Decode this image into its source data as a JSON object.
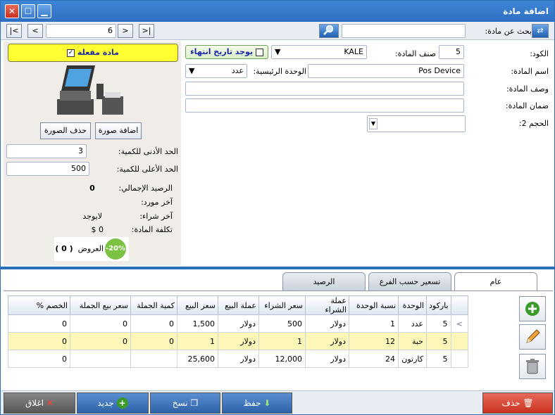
{
  "window": {
    "title": "اضافة مادة"
  },
  "nav": {
    "first": "|<",
    "prev": "<",
    "record": "6",
    "next": ">",
    "last": ">|",
    "search_label": "بحث عن مادة:",
    "search_value": ""
  },
  "left": {
    "active_label": "مادة مفعلة",
    "add_image": "اضافة صورة",
    "delete_image": "حذف الصورة",
    "min_qty_label": "الحد الأدنى للكمية:",
    "min_qty": "3",
    "max_qty_label": "الحد الأعلى للكمية:",
    "max_qty": "500",
    "total_balance_label": "الرصيد الإجمالي:",
    "total_balance": "0",
    "last_supplier_label": "آخر مورد:",
    "last_supplier": "",
    "last_purchase_label": "آخر شراء:",
    "last_purchase": "لايوجد",
    "cost_label": "تكلفة المادة:",
    "cost": "0 $",
    "offers_label": "العروض",
    "offers_count": "( 0 )",
    "discount_badge": "-20%"
  },
  "form": {
    "code_label": "الكود:",
    "code": "",
    "category_label": "صنف المادة:",
    "category_num": "5",
    "category": "KALE",
    "expiry_label": "يوجد تاريخ انتهاء",
    "name_label": "اسم المادة:",
    "name": "Pos Device",
    "unit_label": "الوحدة الرئيسية:",
    "unit": "عدد",
    "desc_label": "وصف المادة:",
    "desc": "",
    "warranty_label": "ضمان المادة:",
    "warranty": "",
    "size_label": "الحجم 2:",
    "size": ""
  },
  "tabs": [
    {
      "label": "عام"
    },
    {
      "label": "تسعير حسب الفرع"
    },
    {
      "label": "الرصيد"
    }
  ],
  "grid": {
    "headers": [
      "باركود",
      "الوحدة",
      "نسبة الوحدة",
      "عملة الشراء",
      "سعر الشراء",
      "عملة البيع",
      "سعر البيع",
      "كمية الجملة",
      "سعر بيع الجملة",
      "الخصم %"
    ],
    "rows": [
      [
        "5",
        "عدد",
        "1",
        "دولار",
        "500",
        "دولار",
        "1,500",
        "0",
        "0",
        "0"
      ],
      [
        "5",
        "حبة",
        "12",
        "دولار",
        "1",
        "دولار",
        "1",
        "0",
        "0",
        "0"
      ],
      [
        "5",
        "كارتون",
        "24",
        "دولار",
        "12,000",
        "دولار",
        "25,600",
        "",
        "",
        "0"
      ]
    ]
  },
  "bottom": {
    "delete": "حذف",
    "save": "حفظ",
    "copy": "نسخ",
    "new": "جديد",
    "close": "اغلاق"
  },
  "colors": {
    "title_blue": "#2e6fc1",
    "active_yellow": "#ffff33",
    "selected_row": "#fbf6b8",
    "delete_red": "#d93a3a",
    "button_blue": "#3a6fb0",
    "close_grey": "#666666"
  }
}
